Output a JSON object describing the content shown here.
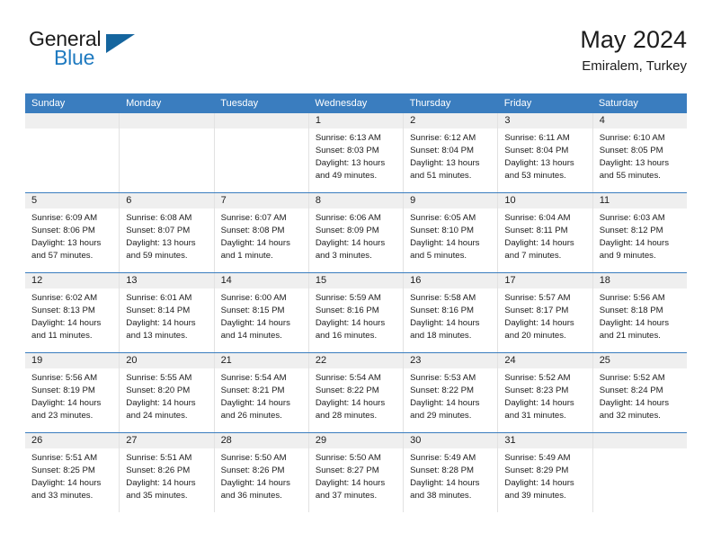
{
  "brand": {
    "name_part1": "General",
    "name_part2": "Blue",
    "logo_icon": "triangle-icon",
    "accent_color": "#1f7ac0",
    "logo_color": "#15659e"
  },
  "header": {
    "title": "May 2024",
    "subtitle": "Emiralem, Turkey"
  },
  "theme": {
    "header_row_color": "#3a7dbf",
    "day_band_color": "#efefef",
    "grid_line_color": "#e2e2e2"
  },
  "weekdays": [
    "Sunday",
    "Monday",
    "Tuesday",
    "Wednesday",
    "Thursday",
    "Friday",
    "Saturday"
  ],
  "weeks": [
    [
      {
        "day": "",
        "sunrise": "",
        "sunset": "",
        "daylight1": "",
        "daylight2": ""
      },
      {
        "day": "",
        "sunrise": "",
        "sunset": "",
        "daylight1": "",
        "daylight2": ""
      },
      {
        "day": "",
        "sunrise": "",
        "sunset": "",
        "daylight1": "",
        "daylight2": ""
      },
      {
        "day": "1",
        "sunrise": "Sunrise: 6:13 AM",
        "sunset": "Sunset: 8:03 PM",
        "daylight1": "Daylight: 13 hours",
        "daylight2": "and 49 minutes."
      },
      {
        "day": "2",
        "sunrise": "Sunrise: 6:12 AM",
        "sunset": "Sunset: 8:04 PM",
        "daylight1": "Daylight: 13 hours",
        "daylight2": "and 51 minutes."
      },
      {
        "day": "3",
        "sunrise": "Sunrise: 6:11 AM",
        "sunset": "Sunset: 8:04 PM",
        "daylight1": "Daylight: 13 hours",
        "daylight2": "and 53 minutes."
      },
      {
        "day": "4",
        "sunrise": "Sunrise: 6:10 AM",
        "sunset": "Sunset: 8:05 PM",
        "daylight1": "Daylight: 13 hours",
        "daylight2": "and 55 minutes."
      }
    ],
    [
      {
        "day": "5",
        "sunrise": "Sunrise: 6:09 AM",
        "sunset": "Sunset: 8:06 PM",
        "daylight1": "Daylight: 13 hours",
        "daylight2": "and 57 minutes."
      },
      {
        "day": "6",
        "sunrise": "Sunrise: 6:08 AM",
        "sunset": "Sunset: 8:07 PM",
        "daylight1": "Daylight: 13 hours",
        "daylight2": "and 59 minutes."
      },
      {
        "day": "7",
        "sunrise": "Sunrise: 6:07 AM",
        "sunset": "Sunset: 8:08 PM",
        "daylight1": "Daylight: 14 hours",
        "daylight2": "and 1 minute."
      },
      {
        "day": "8",
        "sunrise": "Sunrise: 6:06 AM",
        "sunset": "Sunset: 8:09 PM",
        "daylight1": "Daylight: 14 hours",
        "daylight2": "and 3 minutes."
      },
      {
        "day": "9",
        "sunrise": "Sunrise: 6:05 AM",
        "sunset": "Sunset: 8:10 PM",
        "daylight1": "Daylight: 14 hours",
        "daylight2": "and 5 minutes."
      },
      {
        "day": "10",
        "sunrise": "Sunrise: 6:04 AM",
        "sunset": "Sunset: 8:11 PM",
        "daylight1": "Daylight: 14 hours",
        "daylight2": "and 7 minutes."
      },
      {
        "day": "11",
        "sunrise": "Sunrise: 6:03 AM",
        "sunset": "Sunset: 8:12 PM",
        "daylight1": "Daylight: 14 hours",
        "daylight2": "and 9 minutes."
      }
    ],
    [
      {
        "day": "12",
        "sunrise": "Sunrise: 6:02 AM",
        "sunset": "Sunset: 8:13 PM",
        "daylight1": "Daylight: 14 hours",
        "daylight2": "and 11 minutes."
      },
      {
        "day": "13",
        "sunrise": "Sunrise: 6:01 AM",
        "sunset": "Sunset: 8:14 PM",
        "daylight1": "Daylight: 14 hours",
        "daylight2": "and 13 minutes."
      },
      {
        "day": "14",
        "sunrise": "Sunrise: 6:00 AM",
        "sunset": "Sunset: 8:15 PM",
        "daylight1": "Daylight: 14 hours",
        "daylight2": "and 14 minutes."
      },
      {
        "day": "15",
        "sunrise": "Sunrise: 5:59 AM",
        "sunset": "Sunset: 8:16 PM",
        "daylight1": "Daylight: 14 hours",
        "daylight2": "and 16 minutes."
      },
      {
        "day": "16",
        "sunrise": "Sunrise: 5:58 AM",
        "sunset": "Sunset: 8:16 PM",
        "daylight1": "Daylight: 14 hours",
        "daylight2": "and 18 minutes."
      },
      {
        "day": "17",
        "sunrise": "Sunrise: 5:57 AM",
        "sunset": "Sunset: 8:17 PM",
        "daylight1": "Daylight: 14 hours",
        "daylight2": "and 20 minutes."
      },
      {
        "day": "18",
        "sunrise": "Sunrise: 5:56 AM",
        "sunset": "Sunset: 8:18 PM",
        "daylight1": "Daylight: 14 hours",
        "daylight2": "and 21 minutes."
      }
    ],
    [
      {
        "day": "19",
        "sunrise": "Sunrise: 5:56 AM",
        "sunset": "Sunset: 8:19 PM",
        "daylight1": "Daylight: 14 hours",
        "daylight2": "and 23 minutes."
      },
      {
        "day": "20",
        "sunrise": "Sunrise: 5:55 AM",
        "sunset": "Sunset: 8:20 PM",
        "daylight1": "Daylight: 14 hours",
        "daylight2": "and 24 minutes."
      },
      {
        "day": "21",
        "sunrise": "Sunrise: 5:54 AM",
        "sunset": "Sunset: 8:21 PM",
        "daylight1": "Daylight: 14 hours",
        "daylight2": "and 26 minutes."
      },
      {
        "day": "22",
        "sunrise": "Sunrise: 5:54 AM",
        "sunset": "Sunset: 8:22 PM",
        "daylight1": "Daylight: 14 hours",
        "daylight2": "and 28 minutes."
      },
      {
        "day": "23",
        "sunrise": "Sunrise: 5:53 AM",
        "sunset": "Sunset: 8:22 PM",
        "daylight1": "Daylight: 14 hours",
        "daylight2": "and 29 minutes."
      },
      {
        "day": "24",
        "sunrise": "Sunrise: 5:52 AM",
        "sunset": "Sunset: 8:23 PM",
        "daylight1": "Daylight: 14 hours",
        "daylight2": "and 31 minutes."
      },
      {
        "day": "25",
        "sunrise": "Sunrise: 5:52 AM",
        "sunset": "Sunset: 8:24 PM",
        "daylight1": "Daylight: 14 hours",
        "daylight2": "and 32 minutes."
      }
    ],
    [
      {
        "day": "26",
        "sunrise": "Sunrise: 5:51 AM",
        "sunset": "Sunset: 8:25 PM",
        "daylight1": "Daylight: 14 hours",
        "daylight2": "and 33 minutes."
      },
      {
        "day": "27",
        "sunrise": "Sunrise: 5:51 AM",
        "sunset": "Sunset: 8:26 PM",
        "daylight1": "Daylight: 14 hours",
        "daylight2": "and 35 minutes."
      },
      {
        "day": "28",
        "sunrise": "Sunrise: 5:50 AM",
        "sunset": "Sunset: 8:26 PM",
        "daylight1": "Daylight: 14 hours",
        "daylight2": "and 36 minutes."
      },
      {
        "day": "29",
        "sunrise": "Sunrise: 5:50 AM",
        "sunset": "Sunset: 8:27 PM",
        "daylight1": "Daylight: 14 hours",
        "daylight2": "and 37 minutes."
      },
      {
        "day": "30",
        "sunrise": "Sunrise: 5:49 AM",
        "sunset": "Sunset: 8:28 PM",
        "daylight1": "Daylight: 14 hours",
        "daylight2": "and 38 minutes."
      },
      {
        "day": "31",
        "sunrise": "Sunrise: 5:49 AM",
        "sunset": "Sunset: 8:29 PM",
        "daylight1": "Daylight: 14 hours",
        "daylight2": "and 39 minutes."
      },
      {
        "day": "",
        "sunrise": "",
        "sunset": "",
        "daylight1": "",
        "daylight2": ""
      }
    ]
  ]
}
